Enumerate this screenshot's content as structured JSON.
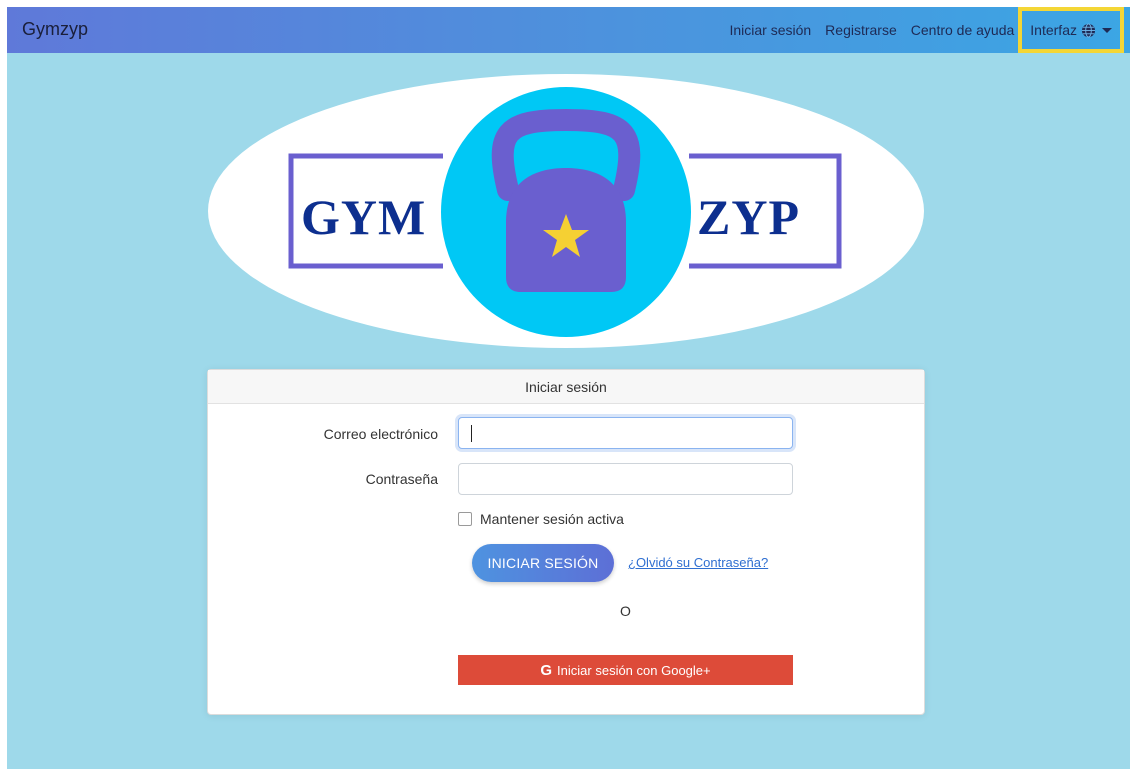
{
  "navbar": {
    "brand": "Gymzyp",
    "links": [
      "Iniciar sesión",
      "Registrarse",
      "Centro de ayuda"
    ],
    "dropdown_label": "Interfaz",
    "dropdown_icon": "globe-icon",
    "highlight_color": "#f4d635"
  },
  "logo": {
    "left_text": "GYM",
    "right_text": "ZYP",
    "colors": {
      "text": "#0d2f8f",
      "frame": "#6a5fcf",
      "circle": "#00c8f5",
      "kettlebell": "#6a5fcf",
      "star": "#f5d033"
    }
  },
  "login_card": {
    "header": "Iniciar sesión",
    "email_label": "Correo electrónico",
    "email_value": "",
    "password_label": "Contraseña",
    "password_value": "",
    "remember_label": "Mantener sesión activa",
    "submit_label": "INICIAR SESIÓN",
    "forgot_link": "¿Olvidó su Contraseña?",
    "or_text": "O",
    "google_icon_text": "G",
    "google_label": "Iniciar sesión con Google+"
  },
  "colors": {
    "background": "#9ed9ea",
    "google_button": "#dd4b39",
    "link": "#2f6fd1"
  }
}
